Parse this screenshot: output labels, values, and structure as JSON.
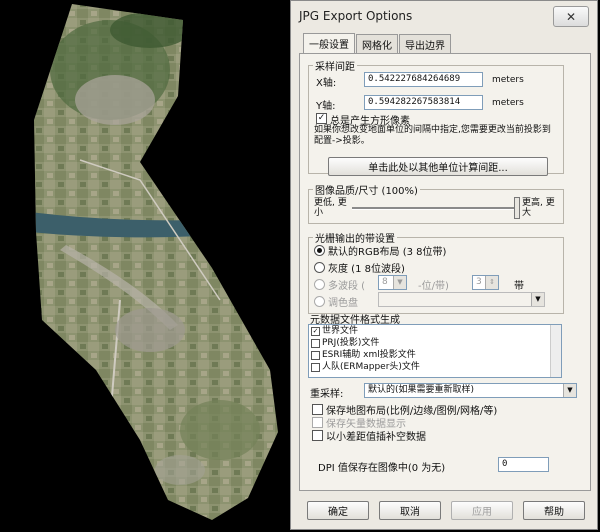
{
  "window": {
    "title": "JPG Export Options",
    "close_glyph": "✕"
  },
  "tabs": [
    {
      "label": "一般设置"
    },
    {
      "label": "网格化"
    },
    {
      "label": "导出边界"
    }
  ],
  "sample_spacing": {
    "legend": "采样间距",
    "x_label": "X轴:",
    "x_value": "0.542227684264689",
    "x_unit": "meters",
    "y_label": "Y轴:",
    "y_value": "0.594282267583814",
    "y_unit": "meters",
    "square_pixels_label": "总是产生方形像素",
    "square_pixels_checked": true,
    "note": "如果你想改变地面单位的间隔中指定,您需要更改当前投影到配置->投影。",
    "calc_button": "单击此处以其他单位计算间距..."
  },
  "quality": {
    "legend": "图像品质/尺寸 (100%)",
    "low_label": "更低, 更小",
    "high_label": "更高, 更大",
    "level_fraction": 1.0
  },
  "bands": {
    "legend": "光栅输出的带设置",
    "options": [
      {
        "label": "默认的RGB布局 (3 8位带)",
        "selected": true,
        "enabled": true
      },
      {
        "label": "灰度 (1 8位波段)",
        "selected": false,
        "enabled": true
      },
      {
        "label": "多波段 (",
        "selected": false,
        "enabled": false
      },
      {
        "label": "调色盘",
        "selected": false,
        "enabled": false
      }
    ],
    "bits_value": "8",
    "bits_suffix": "-位/带)",
    "band_count": "3",
    "band_suffix": "带"
  },
  "metadata": {
    "legend": "元数据文件格式生成",
    "items": [
      {
        "label": "世界文件",
        "checked": true
      },
      {
        "label": "PRJ(投影)文件",
        "checked": false
      },
      {
        "label": "ESRI辅助 xml投影文件",
        "checked": false
      },
      {
        "label": "人队(ERMapper头)文件",
        "checked": false
      }
    ]
  },
  "resample": {
    "label": "重采样:",
    "value": "默认的(如果需要重新取样)"
  },
  "options": [
    {
      "label": "保存地图布局(比例/边缘/图例/网格/等)",
      "checked": false,
      "enabled": true
    },
    {
      "label": "保存矢量数据显示",
      "checked": false,
      "enabled": false
    },
    {
      "label": "以小差距值插补空数据",
      "checked": false,
      "enabled": true
    }
  ],
  "dpi": {
    "label": "DPI 值保存在图像中(0 为无)",
    "value": "0"
  },
  "buttons": {
    "ok": "确定",
    "cancel": "取消",
    "apply": "应用",
    "help": "帮助"
  },
  "colors": {
    "dialog_bg": "#ece9e2",
    "panel_bg": "#f4f2ec",
    "field_border": "#7f9db9"
  }
}
